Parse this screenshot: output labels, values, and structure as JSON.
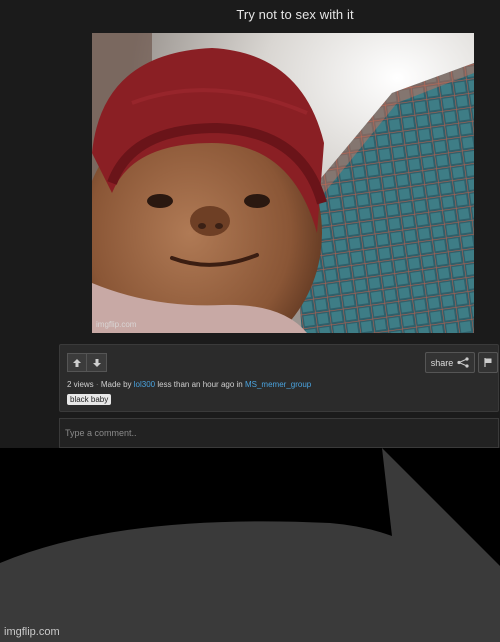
{
  "meme": {
    "title": "Try not to sex with it",
    "image_watermark": "imgflip.com"
  },
  "actions": {
    "upvote_icon": "arrow-up-icon",
    "downvote_icon": "arrow-down-icon",
    "share_label": "share",
    "share_icon": "share-icon",
    "flag_icon": "flag-icon"
  },
  "meta": {
    "views": "2 views",
    "separator": "·",
    "made_by_prefix": "Made by",
    "author": "lol300",
    "time_text": "less than an hour ago in",
    "stream": "MS_memer_group"
  },
  "tags": [
    "black baby"
  ],
  "comment": {
    "placeholder": "Type a comment.."
  },
  "footer": {
    "watermark": "imgflip.com"
  },
  "colors": {
    "link": "#4aa3df",
    "background": "#1b1b1b",
    "speech_bubble": "#3a3a3a"
  }
}
